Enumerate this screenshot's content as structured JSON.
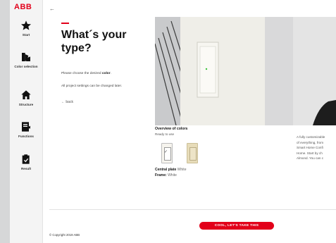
{
  "brand": {
    "logo_text": "ABB",
    "accent": "#e2001a"
  },
  "sidebar": {
    "items": [
      {
        "label": "Start",
        "icon": "star-icon"
      },
      {
        "label": "Color selection",
        "icon": "color-selection-icon"
      },
      {
        "label": "Structure",
        "icon": "house-icon"
      },
      {
        "label": "Functions",
        "icon": "functions-icon"
      },
      {
        "label": "Result",
        "icon": "clipboard-icon"
      }
    ]
  },
  "header": {
    "back_arrow": "←"
  },
  "main": {
    "title": "What´s your type?",
    "instruction_prefix": "Please choose the desired ",
    "instruction_bold": "color",
    "instruction_suffix": ".",
    "instruction2": "All project settings can be changed later.",
    "back_label": "← back"
  },
  "overview": {
    "title": "Overview of colors",
    "subtitle": "Ready to use",
    "swatches": [
      {
        "name": "White",
        "color": "#f6f4ee",
        "selected": true
      },
      {
        "name": "Almond",
        "color": "#e7dcb9",
        "selected": false
      }
    ],
    "central_plate_label": "Central plate",
    "central_plate_value": "White",
    "frame_label": "Frame",
    "frame_value": "White"
  },
  "description": {
    "lines": [
      "A fully customizable",
      "of everything, from",
      "Smart Home Confi",
      "Home. Start by ch",
      "Almond. You can c"
    ]
  },
  "footer": {
    "cta_label": "COOL, LET'S TAKE THIS",
    "copyright": "© Copyright 2019 ABB"
  }
}
